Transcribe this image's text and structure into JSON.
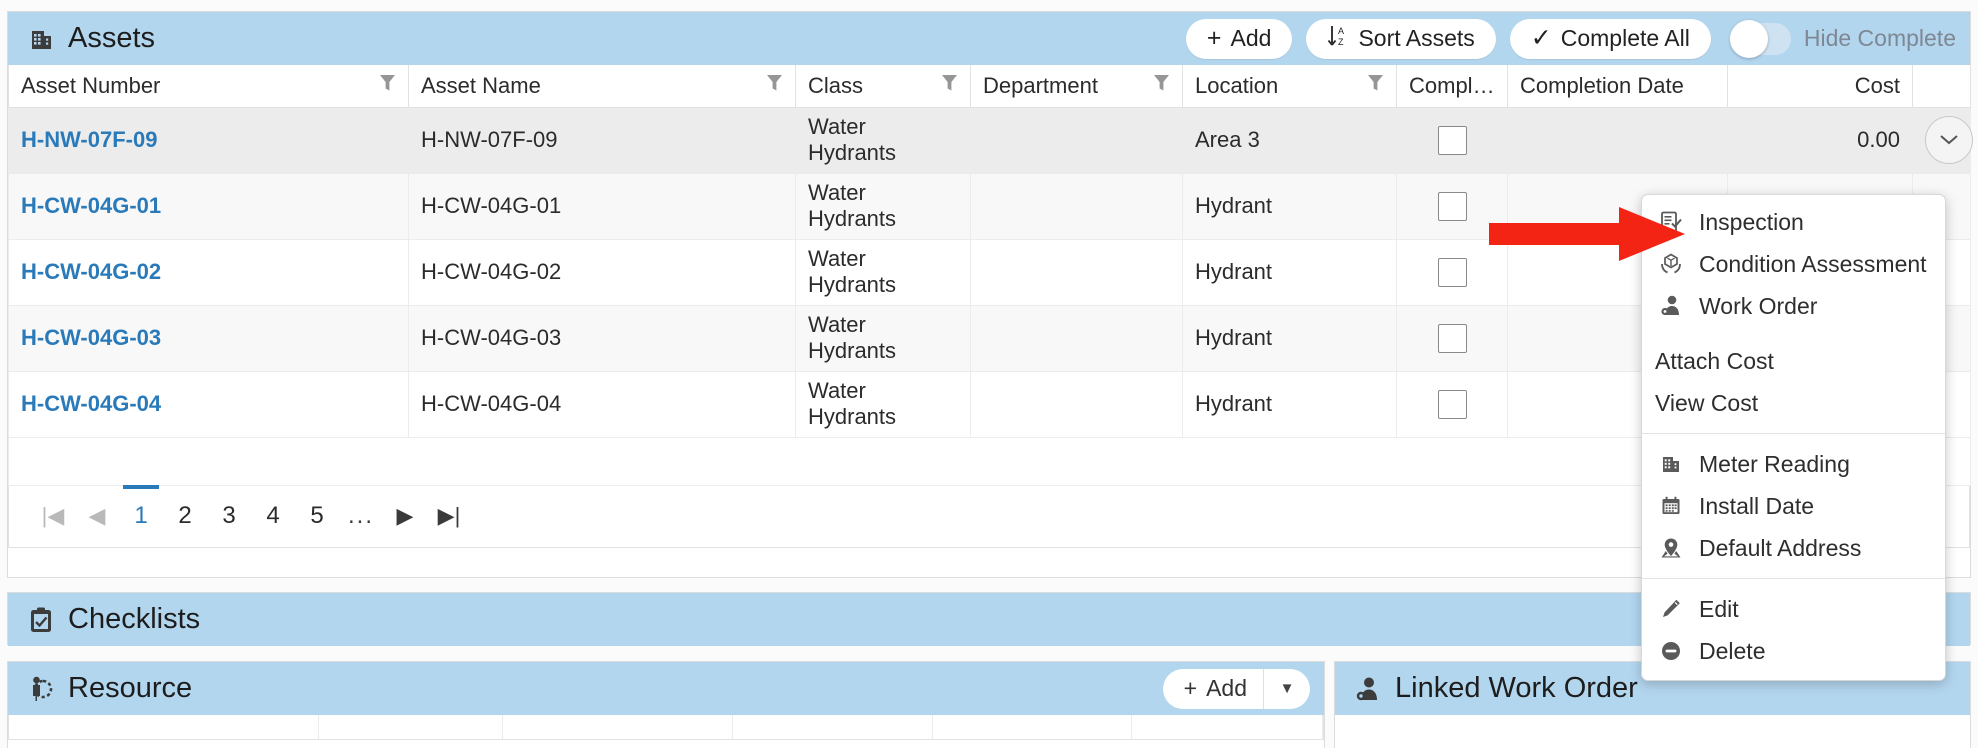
{
  "colors": {
    "panel_header_blue": "#b3d6ef",
    "link_blue": "#2a7ab9",
    "annotation_red": "#f42414",
    "selected_row": "#ececec"
  },
  "assets": {
    "title": "Assets",
    "title_icon": "building-icon",
    "toolbar": {
      "add_label": "Add",
      "add_icon": "plus-icon",
      "sort_label": "Sort Assets",
      "sort_icon": "sort-az-icon",
      "complete_all_label": "Complete All",
      "complete_all_icon": "check-icon",
      "hide_complete_label": "Hide Complete",
      "hide_complete_on": false
    },
    "columns": [
      {
        "label": "Asset Number",
        "filter": true,
        "align": "left"
      },
      {
        "label": "Asset Name",
        "filter": true,
        "align": "left"
      },
      {
        "label": "Class",
        "filter": true,
        "align": "left"
      },
      {
        "label": "Department",
        "filter": true,
        "align": "left"
      },
      {
        "label": "Location",
        "filter": true,
        "align": "left"
      },
      {
        "label": "Comple...",
        "filter": false,
        "align": "left"
      },
      {
        "label": "Completion Date",
        "filter": false,
        "align": "left"
      },
      {
        "label": "Cost",
        "filter": false,
        "align": "right"
      },
      {
        "label": "",
        "filter": false,
        "align": "left"
      }
    ],
    "rows": [
      {
        "asset_number": "H-NW-07F-09",
        "asset_name": "H-NW-07F-09",
        "class": "Water Hydrants",
        "department": "",
        "location": "Area 3",
        "complete": false,
        "completion_date": "",
        "cost": "0.00",
        "selected": true,
        "menu_open": true
      },
      {
        "asset_number": "H-CW-04G-01",
        "asset_name": "H-CW-04G-01",
        "class": "Water Hydrants",
        "department": "",
        "location": "Hydrant",
        "complete": false,
        "completion_date": "",
        "cost": "",
        "selected": false,
        "menu_open": false
      },
      {
        "asset_number": "H-CW-04G-02",
        "asset_name": "H-CW-04G-02",
        "class": "Water Hydrants",
        "department": "",
        "location": "Hydrant",
        "complete": false,
        "completion_date": "",
        "cost": "",
        "selected": false,
        "menu_open": false
      },
      {
        "asset_number": "H-CW-04G-03",
        "asset_name": "H-CW-04G-03",
        "class": "Water Hydrants",
        "department": "",
        "location": "Hydrant",
        "complete": false,
        "completion_date": "",
        "cost": "",
        "selected": false,
        "menu_open": false
      },
      {
        "asset_number": "H-CW-04G-04",
        "asset_name": "H-CW-04G-04",
        "class": "Water Hydrants",
        "department": "",
        "location": "Hydrant",
        "complete": false,
        "completion_date": "",
        "cost": "",
        "selected": false,
        "menu_open": false
      }
    ],
    "pager": {
      "first": "|◀",
      "prev": "◀",
      "pages": [
        "1",
        "2",
        "3",
        "4",
        "5"
      ],
      "ellipsis": "...",
      "next": "▶",
      "last": "▶|",
      "current": "1"
    }
  },
  "context_menu": {
    "groups": [
      {
        "items": [
          {
            "label": "Inspection",
            "icon": "clipboard-check-icon"
          },
          {
            "label": "Condition Assessment",
            "icon": "hands-box-icon"
          },
          {
            "label": "Work Order",
            "icon": "worker-icon"
          }
        ]
      },
      {
        "items": [
          {
            "label": "Attach Cost",
            "icon": ""
          },
          {
            "label": "View Cost",
            "icon": ""
          }
        ]
      },
      {
        "items": [
          {
            "label": "Meter Reading",
            "icon": "building-icon"
          },
          {
            "label": "Install Date",
            "icon": "calendar-icon"
          },
          {
            "label": "Default Address",
            "icon": "map-pin-icon"
          }
        ]
      },
      {
        "items": [
          {
            "label": "Edit",
            "icon": "pencil-icon"
          },
          {
            "label": "Delete",
            "icon": "minus-circle-icon"
          }
        ]
      }
    ]
  },
  "annotation": {
    "type": "arrow",
    "direction": "right",
    "points_to": "Inspection"
  },
  "checklists": {
    "title": "Checklists",
    "title_icon": "clipboard-check-icon"
  },
  "resource": {
    "title": "Resource",
    "title_icon": "resource-person-icon",
    "add_label": "Add",
    "add_icon": "plus-icon",
    "dropdown_icon": "caret-down-icon"
  },
  "linked_work_order": {
    "title": "Linked Work Order",
    "title_icon": "worker-icon"
  }
}
